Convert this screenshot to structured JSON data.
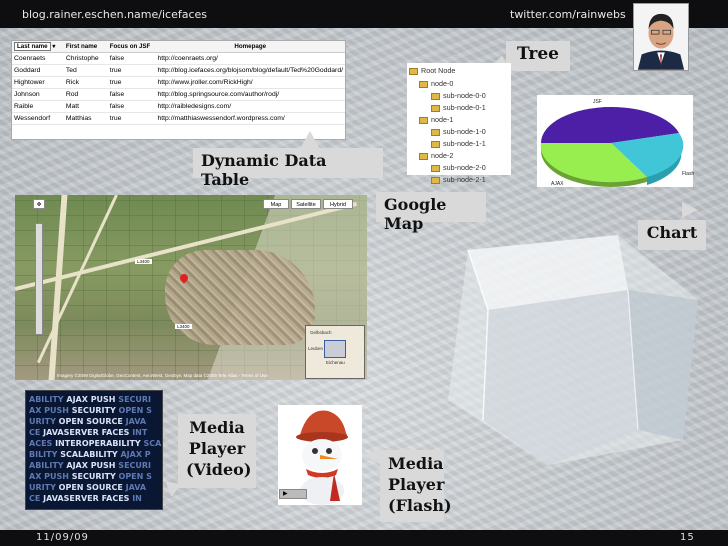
{
  "header": {
    "left_url": "blog.rainer.eschen.name/icefaces",
    "right_url": "twitter.com/rainwebs"
  },
  "footer": {
    "date": "11/09/09",
    "page_number": "15"
  },
  "callouts": {
    "tree": "Tree",
    "data_table": "Dynamic Data Table",
    "google_map": "Google Map",
    "chart": "Chart",
    "media_video": [
      "Media",
      "Player",
      "(Video)"
    ],
    "media_flash": [
      "Media",
      "Player",
      "(Flash)"
    ]
  },
  "data_table": {
    "columns": [
      "Last name",
      "First name",
      "Focus on JSF",
      "Homepage"
    ],
    "rows": [
      [
        "Coenraets",
        "Christophe",
        "false",
        "http://coenraets.org/"
      ],
      [
        "Goddard",
        "Ted",
        "true",
        "http://blog.icefaces.org/blojsom/blog/default/Ted%20Goddard/"
      ],
      [
        "Hightower",
        "Rick",
        "true",
        "http://www.jroller.com/RickHigh/"
      ],
      [
        "Johnson",
        "Rod",
        "false",
        "http://blog.springsource.com/author/rodj/"
      ],
      [
        "Raible",
        "Matt",
        "false",
        "http://raibledesigns.com/"
      ],
      [
        "Wessendorf",
        "Matthias",
        "true",
        "http://matthiaswessendorf.wordpress.com/"
      ]
    ]
  },
  "tree": {
    "root": "Root Node",
    "nodes": [
      {
        "label": "node-0",
        "children": [
          "sub-node-0-0",
          "sub-node-0-1"
        ]
      },
      {
        "label": "node-1",
        "children": [
          "sub-node-1-0",
          "sub-node-1-1"
        ]
      },
      {
        "label": "node-2",
        "children": [
          "sub-node-2-0",
          "sub-node-2-1"
        ]
      }
    ]
  },
  "pie_chart": {
    "labels": {
      "top": "JSF",
      "right": "Flash",
      "left": "AJAX"
    },
    "colors": [
      "#4d1ea6",
      "#41c6d8",
      "#98ee4e"
    ]
  },
  "google_map": {
    "buttons": [
      "Map",
      "Satellite",
      "Hybrid"
    ],
    "road_labels": [
      "L3400",
      "L3400"
    ],
    "copyright": "Imagery ©2009 DigitalGlobe, GeoContent, AeroWest, GeoEye, Map data ©2009 Tele Atlas - Terms of Use",
    "inset_labels": [
      "Gelbsbach",
      "Leuben",
      "Eichenau"
    ]
  },
  "video_lines": [
    [
      "ABILITY ",
      "AJAX PUSH",
      " SECURI"
    ],
    [
      "AX PUSH ",
      "SECURITY",
      " OPEN S"
    ],
    [
      "URITY ",
      "OPEN SOURCE",
      " JAVA"
    ],
    [
      "CE ",
      "JAVASERVER FACES",
      " INT"
    ],
    [
      "ACES ",
      "INTEROPERABILITY",
      " SCA"
    ],
    [
      "BILITY ",
      "SCALABILITY",
      " AJAX P"
    ],
    [
      "ABILITY ",
      "AJAX PUSH",
      " SECURI"
    ],
    [
      "AX PUSH ",
      "SECURITY",
      " OPEN S"
    ],
    [
      "URITY ",
      "OPEN SOURCE",
      " JAVA"
    ],
    [
      "CE ",
      "JAVASERVER FACES",
      " IN"
    ]
  ]
}
